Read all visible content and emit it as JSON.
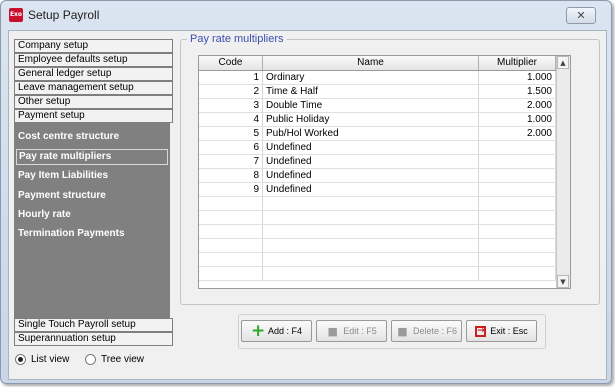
{
  "window": {
    "title": "Setup Payroll",
    "app_icon_text": "Exo",
    "close_symbol": "✕"
  },
  "nav": {
    "top_items": [
      "Company setup",
      "Employee defaults setup",
      "General ledger setup",
      "Leave management setup",
      "Other setup",
      "Payment setup"
    ],
    "sub_items": [
      "Cost centre structure",
      "Pay rate multipliers",
      "Pay Item Liabilities",
      "Payment structure",
      "Hourly rate",
      "Termination Payments"
    ],
    "selected_sub_item": "Pay rate multipliers",
    "bottom_items": [
      "Single Touch Payroll setup",
      "Superannuation setup"
    ]
  },
  "view_mode": {
    "list_label": "List view",
    "tree_label": "Tree view",
    "selected": "List view"
  },
  "panel": {
    "title": "Pay rate multipliers"
  },
  "grid": {
    "columns": {
      "code": "Code",
      "name": "Name",
      "multiplier": "Multiplier"
    },
    "rows": [
      {
        "code": "1",
        "name": "Ordinary",
        "multiplier": "1.000"
      },
      {
        "code": "2",
        "name": "Time & Half",
        "multiplier": "1.500"
      },
      {
        "code": "3",
        "name": "Double Time",
        "multiplier": "2.000"
      },
      {
        "code": "4",
        "name": "Public Holiday",
        "multiplier": "1.000"
      },
      {
        "code": "5",
        "name": "Pub/Hol Worked",
        "multiplier": "2.000"
      },
      {
        "code": "6",
        "name": "Undefined",
        "multiplier": ""
      },
      {
        "code": "7",
        "name": "Undefined",
        "multiplier": ""
      },
      {
        "code": "8",
        "name": "Undefined",
        "multiplier": ""
      },
      {
        "code": "9",
        "name": "Undefined",
        "multiplier": ""
      }
    ]
  },
  "buttons": {
    "add": {
      "label": "Add : F4",
      "icon": "plus-icon",
      "enabled": true
    },
    "edit": {
      "label": "Edit : F5",
      "icon": "edit-icon",
      "enabled": false
    },
    "delete": {
      "label": "Delete : F6",
      "icon": "delete-icon",
      "enabled": false
    },
    "exit": {
      "label": "Exit : Esc",
      "icon": "exit-icon",
      "enabled": true
    }
  },
  "colors": {
    "nav_background": "#808080",
    "panel_title": "#3c4fb0",
    "add_icon": "#2ea52e",
    "exit_icon": "#cc1f1f"
  }
}
